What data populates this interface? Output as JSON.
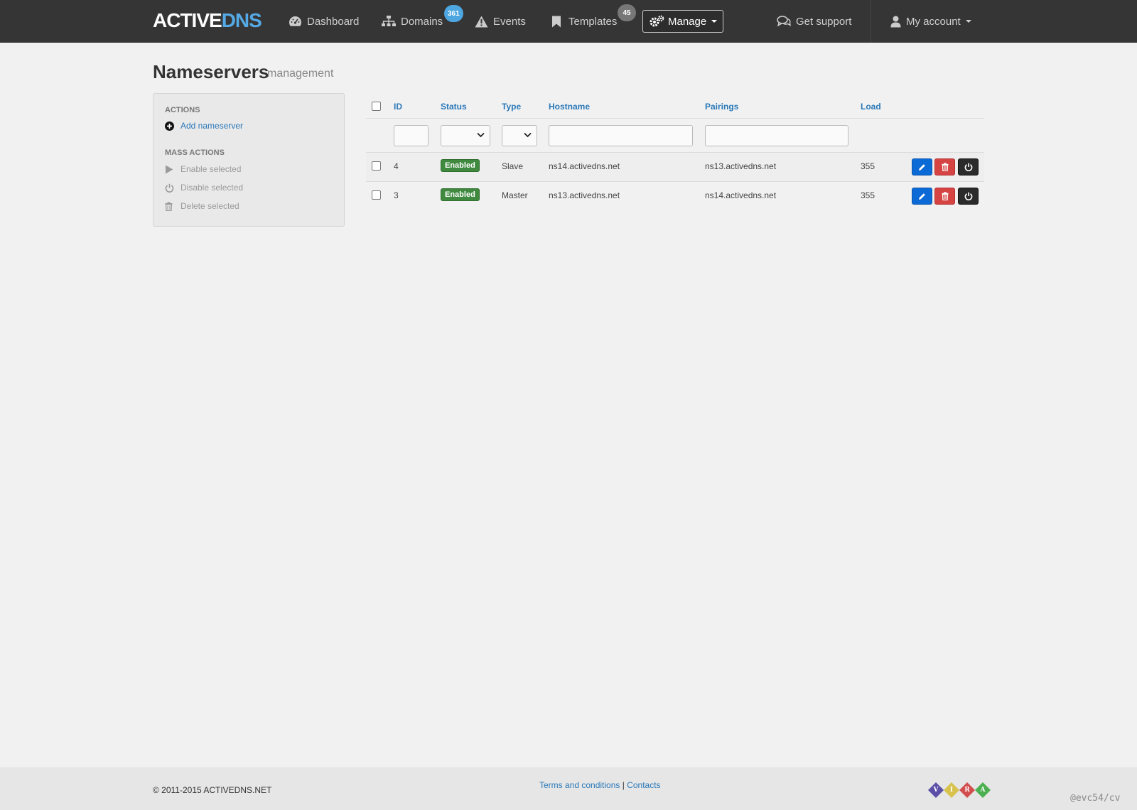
{
  "brand": {
    "part1": "ACTIVE",
    "part2": "DNS"
  },
  "nav": {
    "dashboard": "Dashboard",
    "domains": "Domains",
    "domains_badge": "361",
    "events": "Events",
    "templates": "Templates",
    "templates_badge": "45",
    "manage": "Manage",
    "support": "Get support",
    "account": "My account"
  },
  "page": {
    "title": "Nameservers",
    "subtitle": "management"
  },
  "sidebar": {
    "actions_header": "Actions",
    "add": "Add nameserver",
    "mass_header": "Mass actions",
    "enable": "Enable selected",
    "disable": "Disable selected",
    "delete": "Delete selected"
  },
  "table": {
    "columns": [
      "ID",
      "Status",
      "Type",
      "Hostname",
      "Pairings",
      "Load"
    ],
    "rows": [
      {
        "id": "4",
        "status": "Enabled",
        "type": "Slave",
        "hostname": "ns14.activedns.net",
        "pairings": "ns13.activedns.net",
        "load": "355"
      },
      {
        "id": "3",
        "status": "Enabled",
        "type": "Master",
        "hostname": "ns13.activedns.net",
        "pairings": "ns14.activedns.net",
        "load": "355"
      }
    ]
  },
  "footer": {
    "copyright": "© 2011-2015 ACTIVEDNS.NET",
    "terms": "Terms and conditions",
    "separator": "|",
    "contacts": "Contacts",
    "vira": [
      "V",
      "I",
      "R",
      "A"
    ],
    "watermark": "@evc54/cv"
  },
  "colors": {
    "navbar": "#353535",
    "brand_accent": "#55a9e6",
    "link": "#2a78b8",
    "status_enabled": "#3f8a3f",
    "edit": "#0b6ad6",
    "delete": "#d64343",
    "power": "#2b2b2b"
  }
}
